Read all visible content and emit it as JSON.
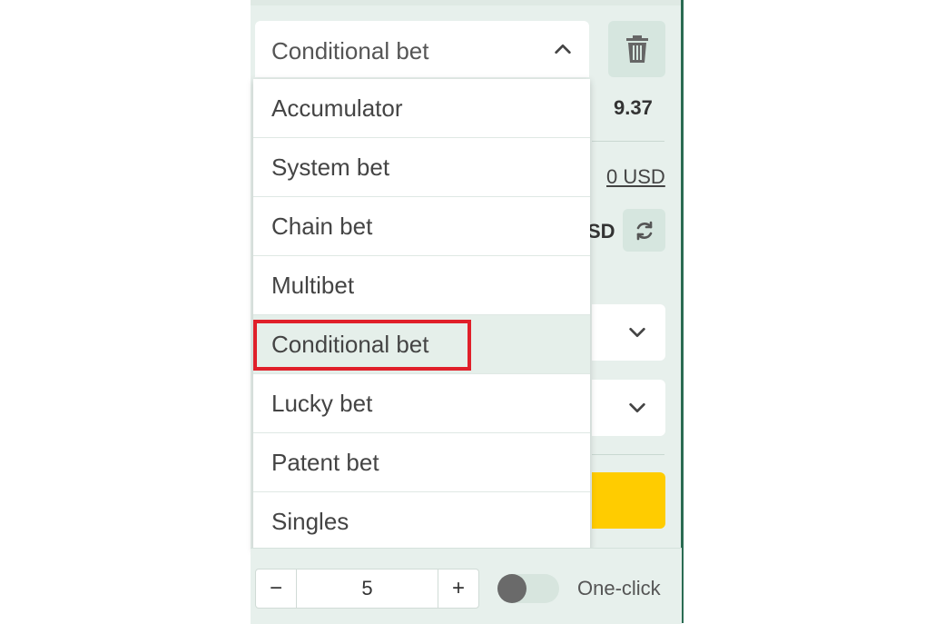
{
  "bet_type_select": {
    "selected": "Conditional bet",
    "options": [
      {
        "label": "Accumulator"
      },
      {
        "label": "System bet"
      },
      {
        "label": "Chain bet"
      },
      {
        "label": "Multibet"
      },
      {
        "label": "Conditional bet",
        "selected": true
      },
      {
        "label": "Lucky bet"
      },
      {
        "label": "Patent bet"
      },
      {
        "label": "Singles"
      }
    ]
  },
  "side": {
    "odds": "9.37",
    "balance_link": "0 USD",
    "currency_partial": "SD"
  },
  "stepper": {
    "minus": "−",
    "value": "5",
    "plus": "+"
  },
  "one_click": {
    "label": "One-click",
    "enabled": false
  },
  "colors": {
    "panel_bg": "#e7f0ec",
    "accent_yellow": "#ffcc00",
    "highlight_red": "#e0202a"
  },
  "icons": [
    "trash-icon",
    "chevron-up-icon",
    "refresh-icon",
    "chevron-down-icon"
  ]
}
